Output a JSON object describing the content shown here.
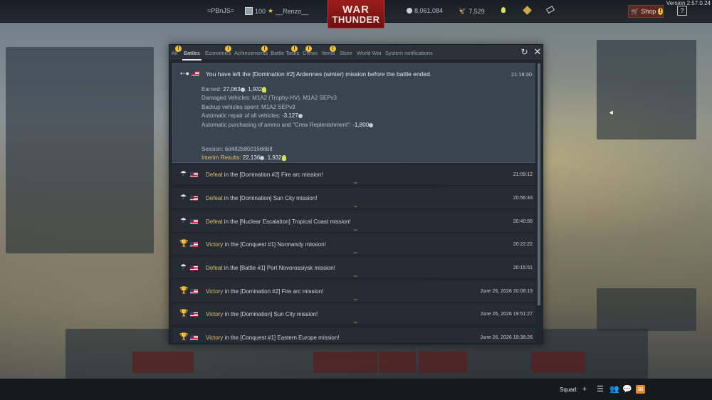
{
  "topbar": {
    "squadron_tag": "=PBnJS=",
    "player_level": "100",
    "player_name": "__Renzo__",
    "logo_line1": "WAR",
    "logo_line2": "THUNDER",
    "silver_lions": "8,061,084",
    "golden_eagles": "7,529",
    "shop_label": "Shop",
    "shop_badge": "!",
    "help_label": "?",
    "version": "Version 2.57.0.24",
    "icons": [
      "player-avatar-icon",
      "star-icon",
      "silver-lions-icon",
      "golden-eagle-icon",
      "lightbulb-icon",
      "warbond-icon",
      "coupon-icon",
      "cart-icon"
    ]
  },
  "modal": {
    "tabs": [
      {
        "label": "All",
        "badge": "!"
      },
      {
        "label": "Battles",
        "badge": ""
      },
      {
        "label": "Economics",
        "badge": "!"
      },
      {
        "label": "Achievements",
        "badge": "!"
      },
      {
        "label": "Battle Tasks",
        "badge": "!"
      },
      {
        "label": "Crews",
        "badge": "!"
      },
      {
        "label": "Items",
        "badge": "!"
      },
      {
        "label": "Store",
        "badge": ""
      },
      {
        "label": "World War",
        "badge": ""
      },
      {
        "label": "System notifications",
        "badge": ""
      }
    ],
    "active_tab": "Battles",
    "refresh_icon": "refresh-icon",
    "close_icon": "close-icon"
  },
  "expanded": {
    "headline": "You have left the [Domination #2] Ardennes (winter) mission before the battle ended.",
    "time": "21:18:30",
    "earned_label": "Earned:",
    "earned_value": "27,063",
    "earned_rp": "1,932",
    "damaged": "Damaged Vehicles: M1A2 (Trophy-HV), M1A2 SEPv3",
    "backup": "Backup vehicles spent: M1A2 SEPv3",
    "repair_label": "Automatic repair of all vehicles:",
    "repair_value": "-3,127",
    "ammo_label": "Automatic purchasing of ammo and \"Crew Replenishment\":",
    "ammo_value": "-1,800",
    "session": "Session: 6d482b8001566b8",
    "interim_label": "Interim Results:",
    "interim_value": "22,136",
    "interim_rp": "1,932"
  },
  "messages": [
    {
      "result": "Defeat",
      "rest": " in the [Domination #2] Fire arc mission!",
      "time": "21:09:12",
      "icon": "parachute-icon"
    },
    {
      "result": "Defeat",
      "rest": " in the [Domination] Sun City mission!",
      "time": "20:56:43",
      "icon": "parachute-icon"
    },
    {
      "result": "Defeat",
      "rest": " in the [Nuclear Escalation] Tropical Coast mission!",
      "time": "20:40:56",
      "icon": "parachute-icon"
    },
    {
      "result": "Victory",
      "rest": " in the [Conquest #1] Normandy mission!",
      "time": "20:22:22",
      "icon": "trophy-icon"
    },
    {
      "result": "Defeat",
      "rest": " in the [Battle #1] Port Novorossiysk mission!",
      "time": "20:15:51",
      "icon": "parachute-icon"
    },
    {
      "result": "Victory",
      "rest": " in the [Domination #2] Fire arc mission!",
      "time": "June 26, 2026 20:08:19",
      "icon": "trophy-icon"
    },
    {
      "result": "Victory",
      "rest": " in the [Domination] Sun City mission!",
      "time": "June 26, 2026 19:51:27",
      "icon": "trophy-icon"
    },
    {
      "result": "Victory",
      "rest": " in the [Conquest #1] Eastern Europe mission!",
      "time": "June 26, 2026 19:38:26",
      "icon": "trophy-icon"
    }
  ],
  "bottombar": {
    "squad_label": "Squad:",
    "icons": [
      "add-squad-icon",
      "list-icon",
      "contacts-icon",
      "chat-icon",
      "mail-icon"
    ]
  }
}
